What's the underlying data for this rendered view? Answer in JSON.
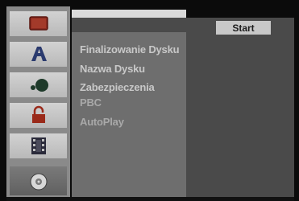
{
  "menu": {
    "items": [
      {
        "label": "Finalizowanie Dysku"
      },
      {
        "label": "Nazwa Dysku"
      },
      {
        "label": "Zabezpieczenia"
      },
      {
        "label": "PBC"
      },
      {
        "label": "AutoPlay"
      }
    ],
    "start_label": "Start"
  },
  "iconbar": {
    "icons": [
      {
        "name": "tv-icon"
      },
      {
        "name": "language-icon"
      },
      {
        "name": "audio-icon"
      },
      {
        "name": "lock-icon"
      },
      {
        "name": "film-icon"
      },
      {
        "name": "disc-icon",
        "selected": true
      }
    ]
  },
  "colors": {
    "panel": "#4a4a4a",
    "menu_column": "#6e6e6e",
    "text": "#c8c8c8",
    "highlight": "#c8c8c8"
  }
}
